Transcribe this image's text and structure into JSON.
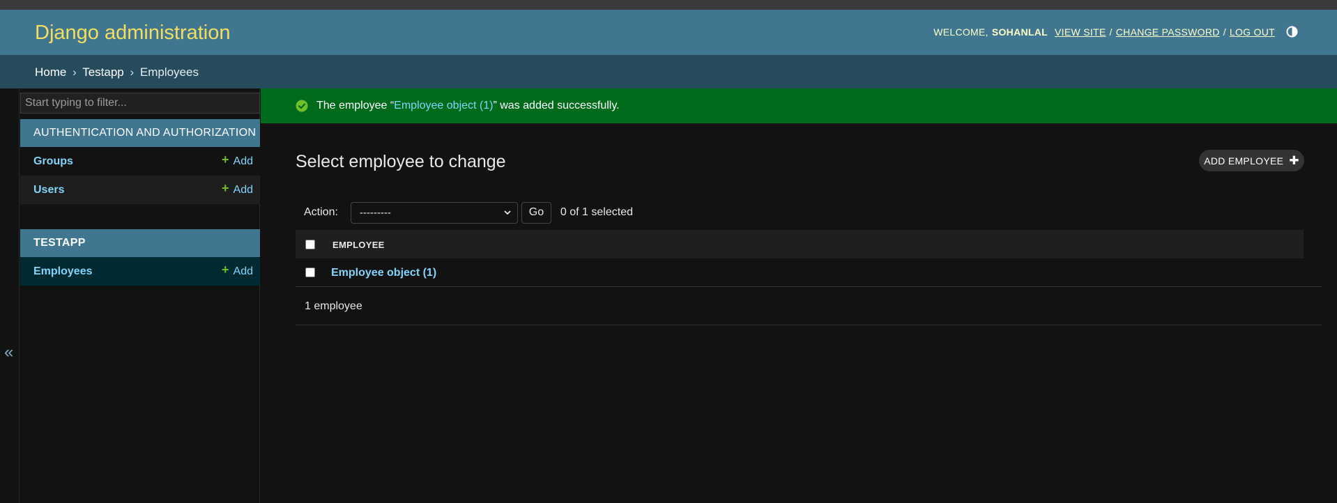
{
  "header": {
    "brand": "Django administration",
    "welcome": "WELCOME,",
    "username": "SOHANLAL",
    "view_site": "VIEW SITE",
    "change_password": "CHANGE PASSWORD",
    "log_out": "LOG OUT",
    "separator": "/"
  },
  "breadcrumbs": {
    "items": [
      "Home",
      "Testapp",
      "Employees"
    ],
    "separator": "›"
  },
  "sidebar": {
    "filter_placeholder": "Start typing to filter...",
    "toggle_label": "«",
    "apps": [
      {
        "caption": "AUTHENTICATION AND AUTHORIZATION",
        "models": [
          {
            "name": "Groups",
            "add": "Add"
          },
          {
            "name": "Users",
            "add": "Add"
          }
        ]
      },
      {
        "caption": "TESTAPP",
        "models": [
          {
            "name": "Employees",
            "add": "Add"
          }
        ]
      }
    ]
  },
  "message": {
    "prefix": "The employee “",
    "link": "Employee object (1)",
    "suffix": "” was added successfully."
  },
  "content": {
    "title": "Select employee to change",
    "add_button": "ADD EMPLOYEE",
    "action_label": "Action:",
    "action_select_value": "---------",
    "go_button": "Go",
    "selection_counter": "0 of 1 selected",
    "column_header": "EMPLOYEE",
    "rows": [
      {
        "label": "Employee object (1)"
      }
    ],
    "paginator": "1 employee"
  },
  "colors": {
    "header_bg": "#417690",
    "brand": "#f5dd5d",
    "breadcrumb_bg": "#264b5d",
    "success_bg": "#006b1b",
    "link": "#81d4fa",
    "add_plus": "#70bf2b"
  }
}
